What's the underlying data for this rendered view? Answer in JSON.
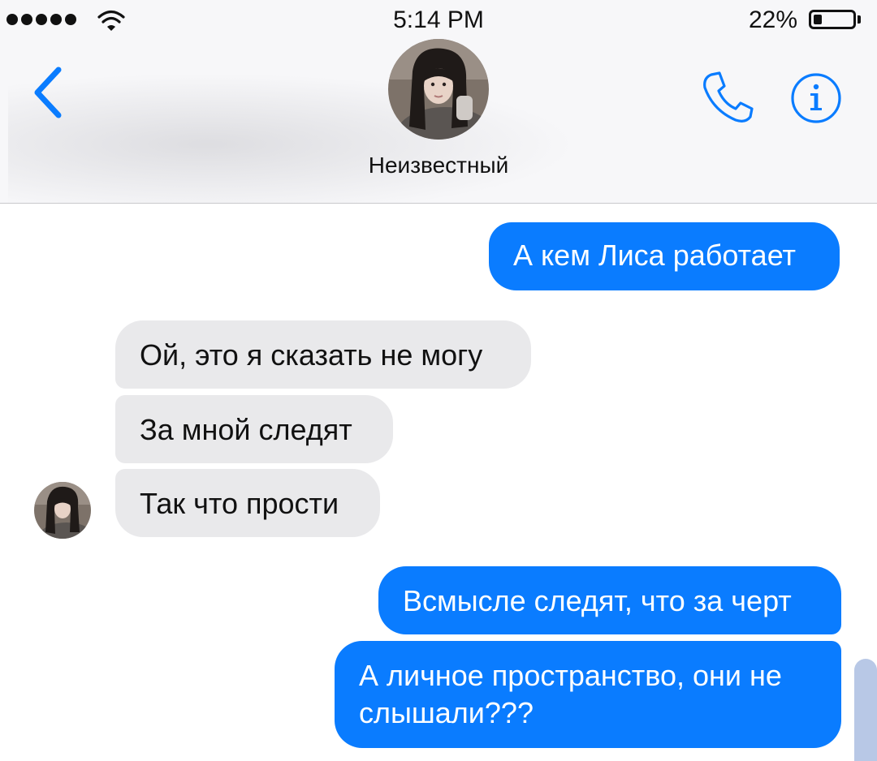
{
  "status_bar": {
    "time": "5:14 PM",
    "battery_percent_label": "22%",
    "battery_level": 0.22,
    "signal_bars": 5,
    "wifi_icon": "wifi-icon"
  },
  "header": {
    "contact_name": "Неизвестный",
    "back_icon": "chevron-left-icon",
    "call_icon": "phone-icon",
    "info_icon": "info-icon",
    "accent_color": "#0a7cff"
  },
  "messages": [
    {
      "direction": "outgoing",
      "text": "А кем Лиса работает"
    },
    {
      "direction": "incoming",
      "text": "Ой, это я сказать не могу"
    },
    {
      "direction": "incoming",
      "text": "За мной следят"
    },
    {
      "direction": "incoming",
      "text": "Так что прости"
    },
    {
      "direction": "outgoing",
      "text": "Всмысле следят, что за черт"
    },
    {
      "direction": "outgoing",
      "text": "А личное пространство, они не слышали???"
    }
  ],
  "colors": {
    "outgoing_bubble": "#0a7cff",
    "incoming_bubble": "#e9e9eb"
  }
}
